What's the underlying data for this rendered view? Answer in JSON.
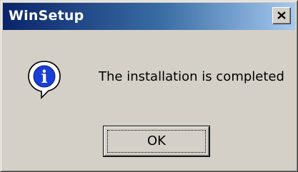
{
  "window": {
    "title": "WinSetup",
    "close_icon": "close-icon",
    "titlebar_color": "#0a246a"
  },
  "dialog": {
    "icon": "info-icon",
    "icon_glyph": "i",
    "message": "The installation is completed",
    "ok_label": "OK"
  }
}
